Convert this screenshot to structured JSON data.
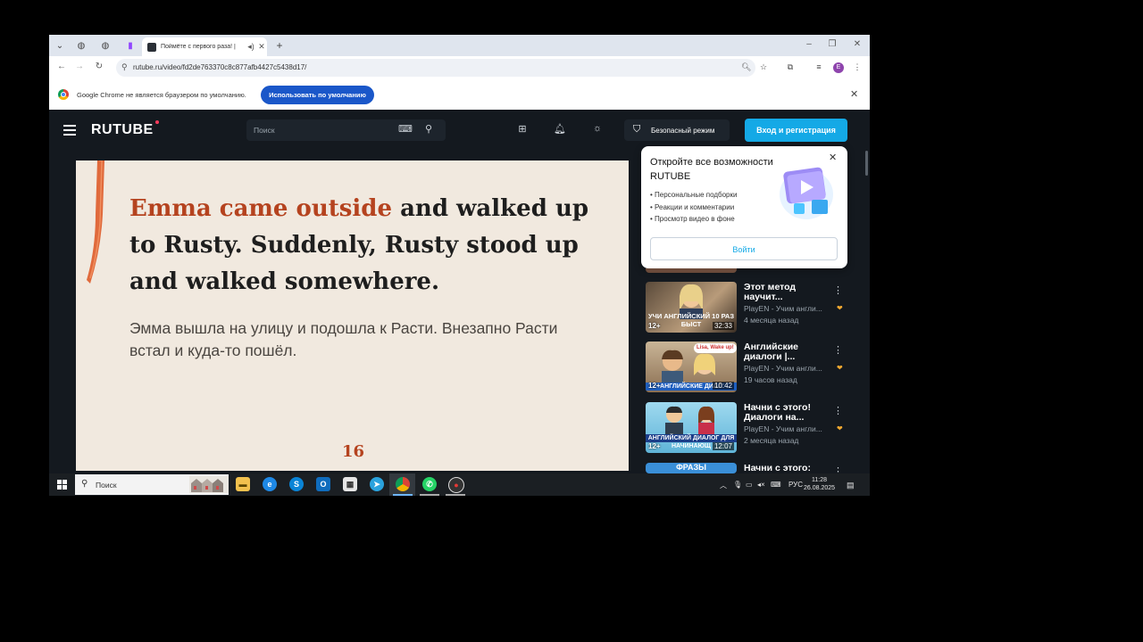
{
  "browser": {
    "tab_title": "Поймёте с первого раза! |",
    "url": "rutube.ru/video/fd2de763370c8c877afb4427c5438d17/",
    "profile_initial": "E",
    "default_msg": "Google Chrome не является браузером по умолчанию.",
    "default_btn": "Использовать по умолчанию"
  },
  "header": {
    "logo": "RUTUBE",
    "search_placeholder": "Поиск",
    "safe_mode": "Безопасный режим",
    "login": "Вход и регистрация"
  },
  "video": {
    "en_highlight": "Emma came outside",
    "en_rest": " and walked up to Rusty. Suddenly, Rusty stood up and walked somewhere.",
    "ru": "Эмма вышла на улицу и подошла к Расти. Внезапно Расти встал и куда-то пошёл.",
    "page": "16"
  },
  "popup": {
    "title": "Откройте все возможности RUTUBE",
    "bullets": [
      "• Персональные подборки",
      "• Реакции и комментарии",
      "• Просмотр видео в фоне"
    ],
    "button": "Войти"
  },
  "recommendations": [
    {
      "title": "Этот метод научит...",
      "channel": "PlayEN - Учим англи...",
      "date": "4 месяца назад",
      "age": "12+",
      "duration": "32:33",
      "caption": "УЧИ АНГЛИЙСКИЙ 10 РАЗ БЫСТ"
    },
    {
      "title": "Английские диалоги |...",
      "channel": "PlayEN - Учим англи...",
      "date": "19 часов назад",
      "age": "12+",
      "duration": "10:42",
      "caption": "АНГЛИЙСКИЕ ДИАЛ",
      "bubble": "Lisa, Wake up!"
    },
    {
      "title": "Начни с этого! Диалоги на...",
      "channel": "PlayEN - Учим англи...",
      "date": "2 месяца назад",
      "age": "12+",
      "duration": "12:07",
      "caption": "АНГЛИЙСКИЙ ДИАЛОГ ДЛЯ НАЧИНАЮЩ"
    },
    {
      "title": "Начни с этого:",
      "caption": "ФРАЗЫ"
    }
  ],
  "taskbar": {
    "search_placeholder": "Поиск",
    "lang": "РУС",
    "time": "11:28",
    "date": "26.08.2025"
  }
}
